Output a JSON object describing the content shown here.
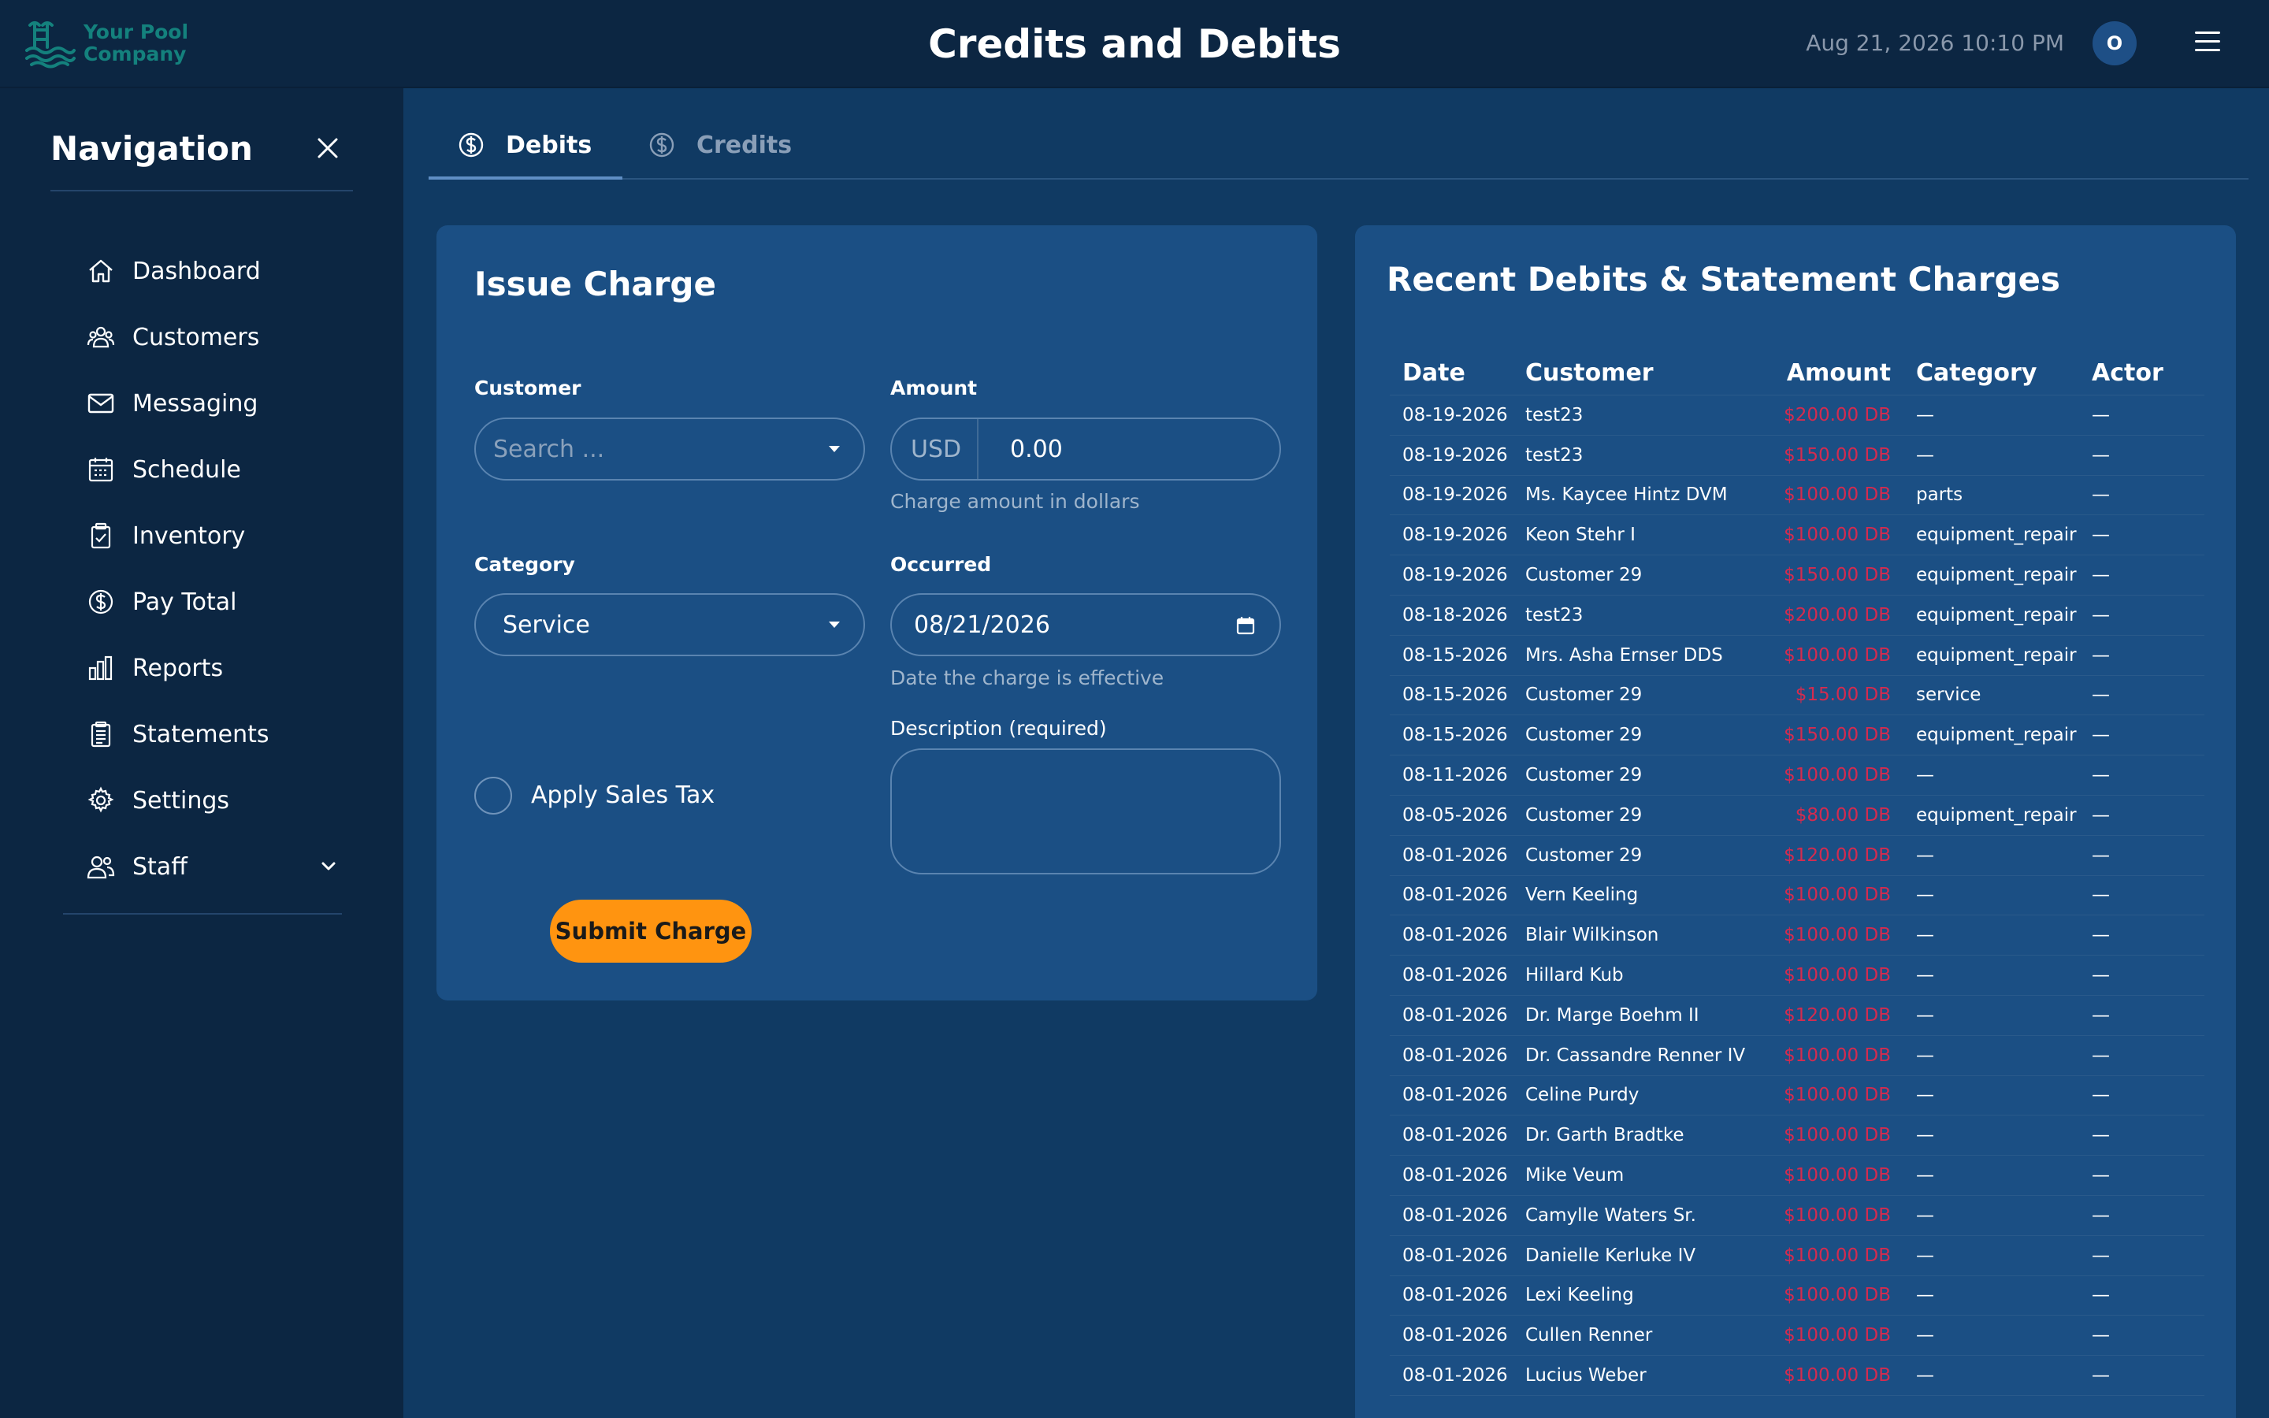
{
  "app": {
    "logo_text": "Your Pool Company",
    "page_title": "Credits and Debits",
    "datetime": "Aug 21, 2026 10:10 PM",
    "avatar_initial": "O"
  },
  "sidebar": {
    "title": "Navigation",
    "items": [
      {
        "label": "Dashboard",
        "icon": "home-icon"
      },
      {
        "label": "Customers",
        "icon": "users-icon"
      },
      {
        "label": "Messaging",
        "icon": "envelope-icon"
      },
      {
        "label": "Schedule",
        "icon": "calendar-icon"
      },
      {
        "label": "Inventory",
        "icon": "clipboard-check-icon"
      },
      {
        "label": "Pay Total",
        "icon": "dollar-circle-icon"
      },
      {
        "label": "Reports",
        "icon": "bar-chart-icon"
      },
      {
        "label": "Statements",
        "icon": "document-list-icon"
      },
      {
        "label": "Settings",
        "icon": "gear-icon"
      },
      {
        "label": "Staff",
        "icon": "people-icon"
      }
    ]
  },
  "tabs": [
    {
      "label": "Debits",
      "active": true
    },
    {
      "label": "Credits",
      "active": false
    }
  ],
  "issue_charge": {
    "title": "Issue Charge",
    "customer_label": "Customer",
    "customer_placeholder": "Search ...",
    "amount_label": "Amount",
    "currency": "USD",
    "amount_value": "0.00",
    "amount_help": "Charge amount in dollars",
    "category_label": "Category",
    "category_value": "Service",
    "occurred_label": "Occurred",
    "occurred_value": "08/21/2026",
    "occurred_help": "Date the charge is effective",
    "description_label": "Description (required)",
    "description_value": "",
    "apply_tax_label": "Apply Sales Tax",
    "submit_label": "Submit Charge"
  },
  "recent": {
    "title": "Recent Debits & Statement Charges",
    "columns": [
      "Date",
      "Customer",
      "Amount",
      "Category",
      "Actor"
    ],
    "rows": [
      {
        "date": "08-19-2026",
        "customer": "test23",
        "amount": "$200.00 DB",
        "category": "—",
        "actor": "—"
      },
      {
        "date": "08-19-2026",
        "customer": "test23",
        "amount": "$150.00 DB",
        "category": "—",
        "actor": "—"
      },
      {
        "date": "08-19-2026",
        "customer": "Ms. Kaycee Hintz DVM",
        "amount": "$100.00 DB",
        "category": "parts",
        "actor": "—"
      },
      {
        "date": "08-19-2026",
        "customer": "Keon Stehr I",
        "amount": "$100.00 DB",
        "category": "equipment_repair",
        "actor": "—"
      },
      {
        "date": "08-19-2026",
        "customer": "Customer 29",
        "amount": "$150.00 DB",
        "category": "equipment_repair",
        "actor": "—"
      },
      {
        "date": "08-18-2026",
        "customer": "test23",
        "amount": "$200.00 DB",
        "category": "equipment_repair",
        "actor": "—"
      },
      {
        "date": "08-15-2026",
        "customer": "Mrs. Asha Ernser DDS",
        "amount": "$100.00 DB",
        "category": "equipment_repair",
        "actor": "—"
      },
      {
        "date": "08-15-2026",
        "customer": "Customer 29",
        "amount": "$15.00 DB",
        "category": "service",
        "actor": "—"
      },
      {
        "date": "08-15-2026",
        "customer": "Customer 29",
        "amount": "$150.00 DB",
        "category": "equipment_repair",
        "actor": "—"
      },
      {
        "date": "08-11-2026",
        "customer": "Customer 29",
        "amount": "$100.00 DB",
        "category": "—",
        "actor": "—"
      },
      {
        "date": "08-05-2026",
        "customer": "Customer 29",
        "amount": "$80.00 DB",
        "category": "equipment_repair",
        "actor": "—"
      },
      {
        "date": "08-01-2026",
        "customer": "Customer 29",
        "amount": "$120.00 DB",
        "category": "—",
        "actor": "—"
      },
      {
        "date": "08-01-2026",
        "customer": "Vern Keeling",
        "amount": "$100.00 DB",
        "category": "—",
        "actor": "—"
      },
      {
        "date": "08-01-2026",
        "customer": "Blair Wilkinson",
        "amount": "$100.00 DB",
        "category": "—",
        "actor": "—"
      },
      {
        "date": "08-01-2026",
        "customer": "Hillard Kub",
        "amount": "$100.00 DB",
        "category": "—",
        "actor": "—"
      },
      {
        "date": "08-01-2026",
        "customer": "Dr. Marge Boehm II",
        "amount": "$120.00 DB",
        "category": "—",
        "actor": "—"
      },
      {
        "date": "08-01-2026",
        "customer": "Dr. Cassandre Renner IV",
        "amount": "$100.00 DB",
        "category": "—",
        "actor": "—"
      },
      {
        "date": "08-01-2026",
        "customer": "Celine Purdy",
        "amount": "$100.00 DB",
        "category": "—",
        "actor": "—"
      },
      {
        "date": "08-01-2026",
        "customer": "Dr. Garth Bradtke",
        "amount": "$100.00 DB",
        "category": "—",
        "actor": "—"
      },
      {
        "date": "08-01-2026",
        "customer": "Mike Veum",
        "amount": "$100.00 DB",
        "category": "—",
        "actor": "—"
      },
      {
        "date": "08-01-2026",
        "customer": "Camylle Waters Sr.",
        "amount": "$100.00 DB",
        "category": "—",
        "actor": "—"
      },
      {
        "date": "08-01-2026",
        "customer": "Danielle Kerluke IV",
        "amount": "$100.00 DB",
        "category": "—",
        "actor": "—"
      },
      {
        "date": "08-01-2026",
        "customer": "Lexi Keeling",
        "amount": "$100.00 DB",
        "category": "—",
        "actor": "—"
      },
      {
        "date": "08-01-2026",
        "customer": "Cullen Renner",
        "amount": "$100.00 DB",
        "category": "—",
        "actor": "—"
      },
      {
        "date": "08-01-2026",
        "customer": "Lucius Weber",
        "amount": "$100.00 DB",
        "category": "—",
        "actor": "—"
      }
    ]
  },
  "colors": {
    "background": "#103a63",
    "sidebar": "#0c2642",
    "card": "#1b4f84",
    "accent_button": "#ff9410",
    "debit_amount": "#d42b4f",
    "logo": "#14817d"
  }
}
